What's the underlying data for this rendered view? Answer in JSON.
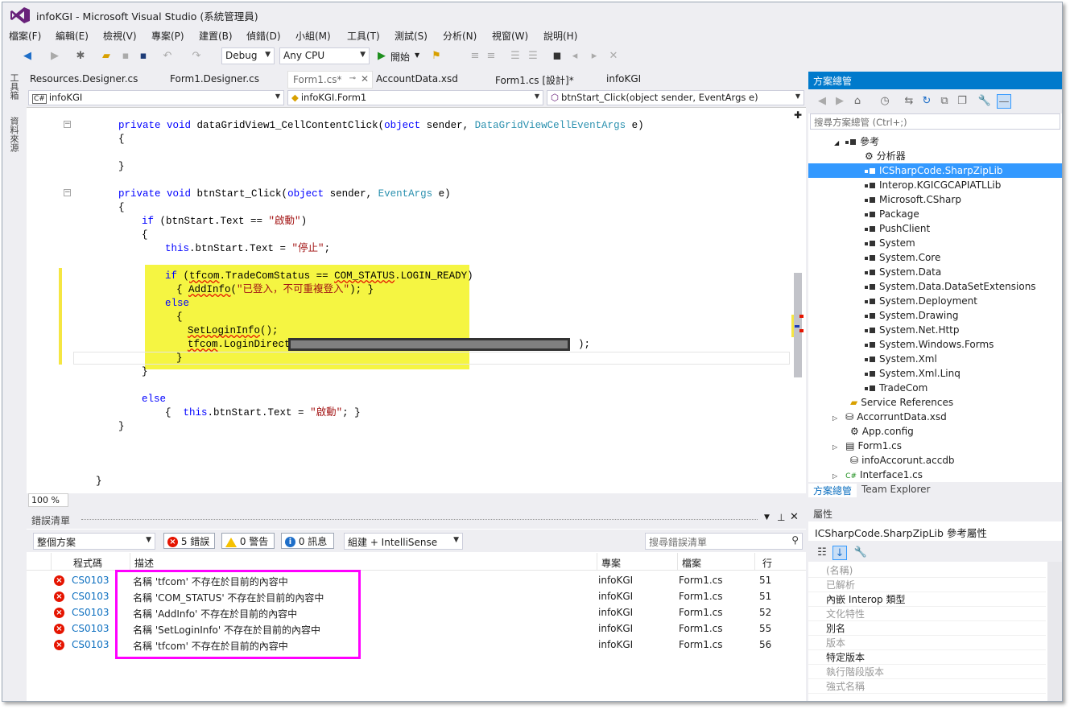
{
  "window": {
    "title": "infoKGI - Microsoft Visual Studio (系統管理員)"
  },
  "menu": [
    "檔案(F)",
    "編輯(E)",
    "檢視(V)",
    "專案(P)",
    "建置(B)",
    "偵錯(D)",
    "小組(M)",
    "工具(T)",
    "測試(S)",
    "分析(N)",
    "視窗(W)",
    "說明(H)"
  ],
  "toolbar": {
    "config": "Debug",
    "platform": "Any CPU",
    "start_label": "開始"
  },
  "sidetabs": [
    "工具箱",
    "資料來源"
  ],
  "doc_tabs": [
    "Resources.Designer.cs",
    "Form1.Designer.cs",
    "Form1.cs*",
    "AccountData.xsd",
    "Form1.cs [設計]*",
    "infoKGI"
  ],
  "nav": {
    "project": "infoKGI",
    "class": "infoKGI.Form1",
    "member": "btnStart_Click(object sender, EventArgs e)"
  },
  "code": {
    "l1a": "private void ",
    "l1b": "dataGridView1_CellContentClick(",
    "l1c": "object",
    "l1d": " sender, ",
    "l1e": "DataGridViewCellEventArgs",
    "l1f": " e)",
    "l2": "{",
    "l3": "}",
    "l4a": "private void ",
    "l4b": "btnStart_Click(",
    "l4c": "object",
    "l4d": " sender, ",
    "l4e": "EventArgs",
    "l4f": " e)",
    "l5": "{",
    "l6a": "if",
    "l6b": " (btnStart.Text == ",
    "l6c": "\"啟動\"",
    "l6d": ")",
    "l7": "{",
    "l8a": "this",
    "l8b": ".btnStart.Text = ",
    "l8c": "\"停止\"",
    "l8d": ";",
    "l9a": "if",
    "l9b": " (",
    "l9c": "tfcom",
    "l9d": ".TradeComStatus == ",
    "l9e": "COM_STATUS",
    "l9f": ".LOGIN_READY)",
    "l10a": "{ ",
    "l10b": "AddInfo",
    "l10c": "(",
    "l10d": "\"已登入，不可重複登入\"",
    "l10e": "); }",
    "l11": "else",
    "l12": "{",
    "l13a": "SetLoginInfo",
    "l13b": "();",
    "l14a": "tfcom",
    "l14b": ".LoginDirect(",
    "l14c": ");",
    "l15": "}",
    "l16": "}",
    "l17": "else",
    "l18a": "{  ",
    "l18b": "this",
    "l18c": ".btnStart.Text = ",
    "l18d": "\"啟動\"",
    "l18e": "; }",
    "l19": "}",
    "l20": "}"
  },
  "zoom": "100 %",
  "error_list": {
    "title": "錯誤清單",
    "scope": "整個方案",
    "errors_btn": "5 錯誤",
    "warnings_btn": "0 警告",
    "messages_btn": "0 訊息",
    "build_filter": "組建 + IntelliSense",
    "search_placeholder": "搜尋錯誤清單",
    "columns": {
      "code": "程式碼",
      "desc": "描述",
      "project": "專案",
      "file": "檔案",
      "line": "行"
    },
    "rows": [
      {
        "code": "CS0103",
        "desc": "名稱 'tfcom' 不存在於目前的內容中",
        "project": "infoKGI",
        "file": "Form1.cs",
        "line": "51"
      },
      {
        "code": "CS0103",
        "desc": "名稱 'COM_STATUS' 不存在於目前的內容中",
        "project": "infoKGI",
        "file": "Form1.cs",
        "line": "51"
      },
      {
        "code": "CS0103",
        "desc": "名稱 'AddInfo' 不存在於目前的內容中",
        "project": "infoKGI",
        "file": "Form1.cs",
        "line": "52"
      },
      {
        "code": "CS0103",
        "desc": "名稱 'SetLoginInfo' 不存在於目前的內容中",
        "project": "infoKGI",
        "file": "Form1.cs",
        "line": "55"
      },
      {
        "code": "CS0103",
        "desc": "名稱 'tfcom' 不存在於目前的內容中",
        "project": "infoKGI",
        "file": "Form1.cs",
        "line": "56"
      }
    ]
  },
  "solution": {
    "title": "方案總管",
    "search_placeholder": "搜尋方案總管 (Ctrl+;)",
    "refs_label": "參考",
    "analyzer": "分析器",
    "refs": [
      "ICSharpCode.SharpZipLib",
      "Interop.KGICGCAPIATLLib",
      "Microsoft.CSharp",
      "Package",
      "PushClient",
      "System",
      "System.Core",
      "System.Data",
      "System.Data.DataSetExtensions",
      "System.Deployment",
      "System.Drawing",
      "System.Net.Http",
      "System.Windows.Forms",
      "System.Xml",
      "System.Xml.Linq",
      "TradeCom"
    ],
    "service_refs": "Service References",
    "files": [
      "AccorruntData.xsd",
      "App.config",
      "Form1.cs",
      "infoAccorunt.accdb",
      "Interface1.cs"
    ],
    "tabs": [
      "方案總管",
      "Team Explorer"
    ]
  },
  "properties": {
    "title": "屬性",
    "object": "ICSharpCode.SharpZipLib  參考屬性",
    "rows": [
      "(名稱)",
      "已解析",
      "內嵌 Interop 類型",
      "文化特性",
      "別名",
      "版本",
      "特定版本",
      "執行階段版本",
      "強式名稱"
    ]
  }
}
